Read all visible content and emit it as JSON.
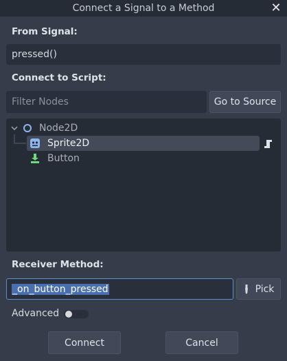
{
  "window": {
    "title": "Connect a Signal to a Method"
  },
  "from_signal": {
    "label": "From Signal:",
    "value": "pressed()"
  },
  "connect_to_script": {
    "label": "Connect to Script:"
  },
  "filter": {
    "placeholder": "Filter Nodes",
    "value": ""
  },
  "go_to_source": {
    "label": "Go to Source"
  },
  "tree": {
    "nodes": [
      {
        "name": "Node2D",
        "icon": "node2d-circle-icon"
      },
      {
        "name": "Sprite2D",
        "icon": "sprite2d-icon",
        "selected": true,
        "has_script": true
      },
      {
        "name": "Button",
        "icon": "button-icon"
      }
    ]
  },
  "receiver": {
    "label": "Receiver Method:",
    "value": "_on_button_pressed"
  },
  "pick": {
    "label": "Pick"
  },
  "advanced": {
    "label": "Advanced",
    "enabled": false
  },
  "actions": {
    "connect": "Connect",
    "cancel": "Cancel"
  },
  "colors": {
    "accent": "#5f8fcf",
    "node2d": "#8eb6f2",
    "button_icon": "#6fdc7a"
  }
}
